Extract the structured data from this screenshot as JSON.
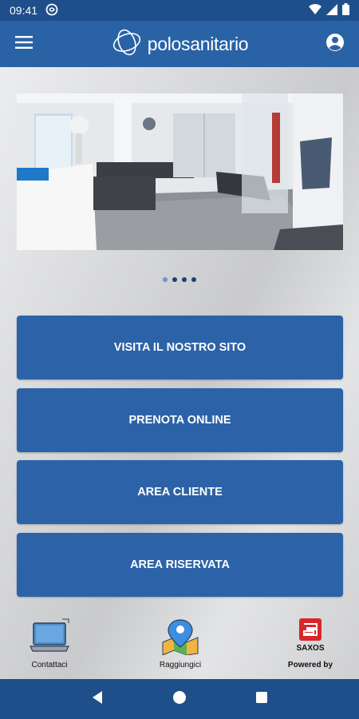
{
  "status_bar": {
    "time": "09:41"
  },
  "app_bar": {
    "logo_text": "polosanitario"
  },
  "carousel": {
    "total_slides": 4,
    "active_index": 0
  },
  "buttons": [
    {
      "label": "VISITA IL NOSTRO SITO"
    },
    {
      "label": "PRENOTA ONLINE"
    },
    {
      "label": "AREA CLIENTE"
    },
    {
      "label": "AREA RISERVATA"
    }
  ],
  "footer": {
    "contact": {
      "label": "Contattaci",
      "icon": "laptop-icon"
    },
    "directions": {
      "label": "Raggiungici",
      "icon": "map-pin-icon"
    },
    "powered": {
      "label": "Powered by",
      "brand": "SAXOS",
      "icon": "saxos-logo"
    }
  },
  "colors": {
    "primary": "#2c63a8",
    "status_bar": "#1e4f8a",
    "app_bar": "#2a62a6"
  }
}
